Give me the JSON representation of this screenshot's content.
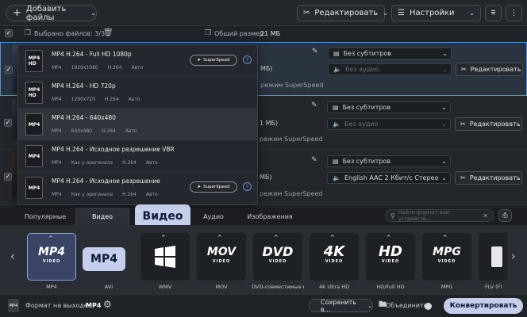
{
  "toolbar": {
    "add_files_label": "Добавить файлы",
    "edit_label": "Редактировать",
    "settings_label": "Настройки"
  },
  "selection": {
    "selected_label": "Выбрано файлов: 3/3",
    "total_size_label": "Общий размер:",
    "total_size_value": "21 МБ"
  },
  "rows": [
    {
      "size_partial": "МБ)",
      "subtitles": "Без субтитров",
      "audio": "Без аудио",
      "superspeed": "режим SuperSpeed",
      "edit": "Редактировать"
    },
    {
      "size_partial": "1 МБ)",
      "subtitles": "Без субтитров",
      "audio": "Без аудио",
      "superspeed": "режим SuperSpeed",
      "edit": "Редактировать"
    },
    {
      "size_partial": "МБ)",
      "subtitles": "Без субтитров",
      "audio": "English AAC 2 Кбит/с Стерео",
      "superspeed": "режим SuperSpeed",
      "edit": "Редактировать"
    }
  ],
  "dropdown": {
    "options": [
      {
        "title": "MP4 H.264 - Full HD 1080p",
        "sub": [
          "MP4",
          "1920x1080",
          "H.264",
          "Авто"
        ],
        "superspeed": true
      },
      {
        "title": "MP4 H.264 - HD 720p",
        "sub": [
          "MP4",
          "1280x720",
          "H.264",
          "Авто"
        ],
        "superspeed": false
      },
      {
        "title": "MP4 H.264 - 640x480",
        "sub": [
          "MP4",
          "640x480",
          "H.264",
          "Авто"
        ],
        "superspeed": false
      },
      {
        "title": "MP4 H.264 - Исходное разрешение VBR",
        "sub": [
          "MP4",
          "Как у оригинала",
          "H.264",
          "Авто"
        ],
        "superspeed": false
      },
      {
        "title": "MP4 H.264 - Исходное разрешение",
        "sub": [
          "MP4",
          "Как у оригинала",
          "H.264",
          "Авто"
        ],
        "superspeed": true
      }
    ],
    "superspeed_label": "SuperSpeed"
  },
  "tabs": {
    "popular": "Популярные",
    "video": "Видео",
    "audio": "Аудио",
    "images": "Изображения",
    "callout": "Видео",
    "search_placeholder": "Найти формат или устройств..."
  },
  "formats": [
    {
      "logo": "MP4",
      "sub": "VIDEO",
      "label": "MP4"
    },
    {
      "logo": "",
      "sub": "",
      "label": "AVI"
    },
    {
      "logo": "",
      "sub": "",
      "label": "WMV"
    },
    {
      "logo": "MOV",
      "sub": "VIDEO",
      "label": "MOV"
    },
    {
      "logo": "DVD",
      "sub": "VIDEO",
      "label": "DVD-совместимые в..."
    },
    {
      "logo": "4K",
      "sub": "VIDEO",
      "label": "4K Ultra HD"
    },
    {
      "logo": "HD",
      "sub": "VIDEO",
      "label": "HD/Full HD"
    },
    {
      "logo": "MPG",
      "sub": "VIDEO",
      "label": "MPG"
    },
    {
      "logo": "",
      "sub": "",
      "label": "FLV (Fl"
    }
  ],
  "format_callout": "MP4",
  "bottom": {
    "output_label": "Формат на выходе:",
    "output_value": "MP4",
    "save_label": "Сохранить в...",
    "merge_label": "Объединить:",
    "convert_label": "Конвертировать"
  },
  "colors": {
    "accent": "#c5cfeb",
    "selection_border": "#5b8bd6"
  }
}
